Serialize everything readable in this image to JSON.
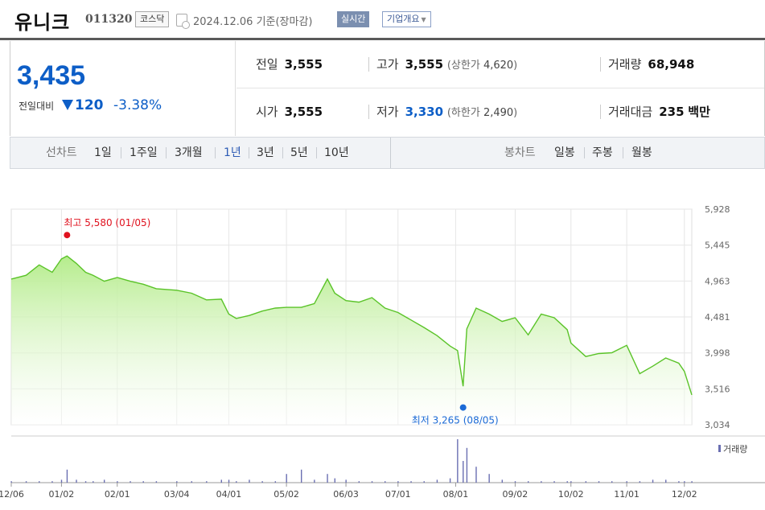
{
  "header": {
    "name": "유니크",
    "code": "011320",
    "market": "코스닥",
    "date": "2024.12.06 기준(장마감)",
    "realtime_label": "실시간",
    "overview_label": "기업개요"
  },
  "price": {
    "current": "3,435",
    "prev_label": "전일대비",
    "change": "120",
    "change_pct": "-3.38%",
    "color_down": "#0d5ec7"
  },
  "stats": {
    "prev_close_label": "전일",
    "prev_close": "3,555",
    "high_label": "고가",
    "high": "3,555",
    "upper_limit_label": "상한가",
    "upper_limit": "4,620",
    "volume_label": "거래량",
    "volume": "68,948",
    "open_label": "시가",
    "open": "3,555",
    "low_label": "저가",
    "low": "3,330",
    "lower_limit_label": "하한가",
    "lower_limit": "2,490",
    "turnover_label": "거래대금",
    "turnover": "235",
    "turnover_unit": "백만"
  },
  "tabs": {
    "line_label": "선차트",
    "line": [
      "1일",
      "1주일",
      "3개월",
      "1년",
      "3년",
      "5년",
      "10년"
    ],
    "active": "1년",
    "candle_label": "봉차트",
    "candle": [
      "일봉",
      "주봉",
      "월봉"
    ]
  },
  "chart_data": {
    "type": "area",
    "x_ticks": [
      "12/06",
      "01/02",
      "02/01",
      "03/04",
      "04/01",
      "05/02",
      "06/03",
      "07/01",
      "08/01",
      "09/02",
      "10/02",
      "11/01",
      "12/02"
    ],
    "y_ticks": [
      5928,
      5445,
      4963,
      4481,
      3998,
      3516,
      3034
    ],
    "ylim": [
      3034,
      5928
    ],
    "x_range": [
      "2023-12-06",
      "2024-12-06"
    ],
    "series": [
      {
        "x": [
          "2023-12-06",
          "2023-12-14",
          "2023-12-21",
          "2023-12-28",
          "2024-01-02",
          "2024-01-05",
          "2024-01-10",
          "2024-01-15",
          "2024-01-19",
          "2024-01-25",
          "2024-02-01",
          "2024-02-08",
          "2024-02-15",
          "2024-02-22",
          "2024-03-04",
          "2024-03-12",
          "2024-03-20",
          "2024-03-28",
          "2024-04-01",
          "2024-04-05",
          "2024-04-12",
          "2024-04-19",
          "2024-04-26",
          "2024-05-02",
          "2024-05-10",
          "2024-05-17",
          "2024-05-24",
          "2024-05-28",
          "2024-06-03",
          "2024-06-10",
          "2024-06-17",
          "2024-06-24",
          "2024-07-01",
          "2024-07-08",
          "2024-07-15",
          "2024-07-22",
          "2024-07-29",
          "2024-08-02",
          "2024-08-05",
          "2024-08-07",
          "2024-08-12",
          "2024-08-19",
          "2024-08-26",
          "2024-09-02",
          "2024-09-09",
          "2024-09-16",
          "2024-09-23",
          "2024-09-30",
          "2024-10-02",
          "2024-10-10",
          "2024-10-17",
          "2024-10-24",
          "2024-11-01",
          "2024-11-08",
          "2024-11-15",
          "2024-11-22",
          "2024-11-29",
          "2024-12-02",
          "2024-12-06"
        ],
        "y": [
          4990,
          5040,
          5180,
          5080,
          5260,
          5300,
          5200,
          5080,
          5040,
          4960,
          5010,
          4960,
          4920,
          4860,
          4840,
          4800,
          4710,
          4720,
          4520,
          4460,
          4500,
          4560,
          4600,
          4610,
          4610,
          4660,
          4990,
          4800,
          4700,
          4680,
          4740,
          4600,
          4540,
          4440,
          4340,
          4230,
          4090,
          4030,
          3550,
          4320,
          4600,
          4520,
          4420,
          4470,
          4240,
          4520,
          4470,
          4310,
          4130,
          3950,
          3990,
          4000,
          4100,
          3720,
          3820,
          3930,
          3860,
          3750,
          3435
        ]
      }
    ],
    "high_label": "최고",
    "high_value": "5,580",
    "high_date": "01/05",
    "high": 5580,
    "low_label": "최저",
    "low_value": "3,265",
    "low_date": "08/05",
    "low": 3265,
    "volume_label": "거래량",
    "volume": [
      1,
      1,
      1,
      1,
      2,
      9,
      2,
      1,
      1,
      2,
      1,
      1,
      1,
      1,
      1,
      1,
      1,
      2,
      2,
      1,
      2,
      1,
      1,
      6,
      9,
      2,
      6,
      3,
      2,
      1,
      1,
      1,
      1,
      1,
      1,
      2,
      3,
      30,
      15,
      24,
      11,
      6,
      2,
      1,
      1,
      1,
      1,
      1,
      1,
      1,
      1,
      1,
      1,
      1,
      2,
      2,
      1,
      1,
      1
    ],
    "colors": {
      "line": "#5ac328",
      "fill_top": "#b5ec8c",
      "high": "#e0121f",
      "low": "#1b6ad6",
      "volume": "#6a6fb2"
    }
  }
}
